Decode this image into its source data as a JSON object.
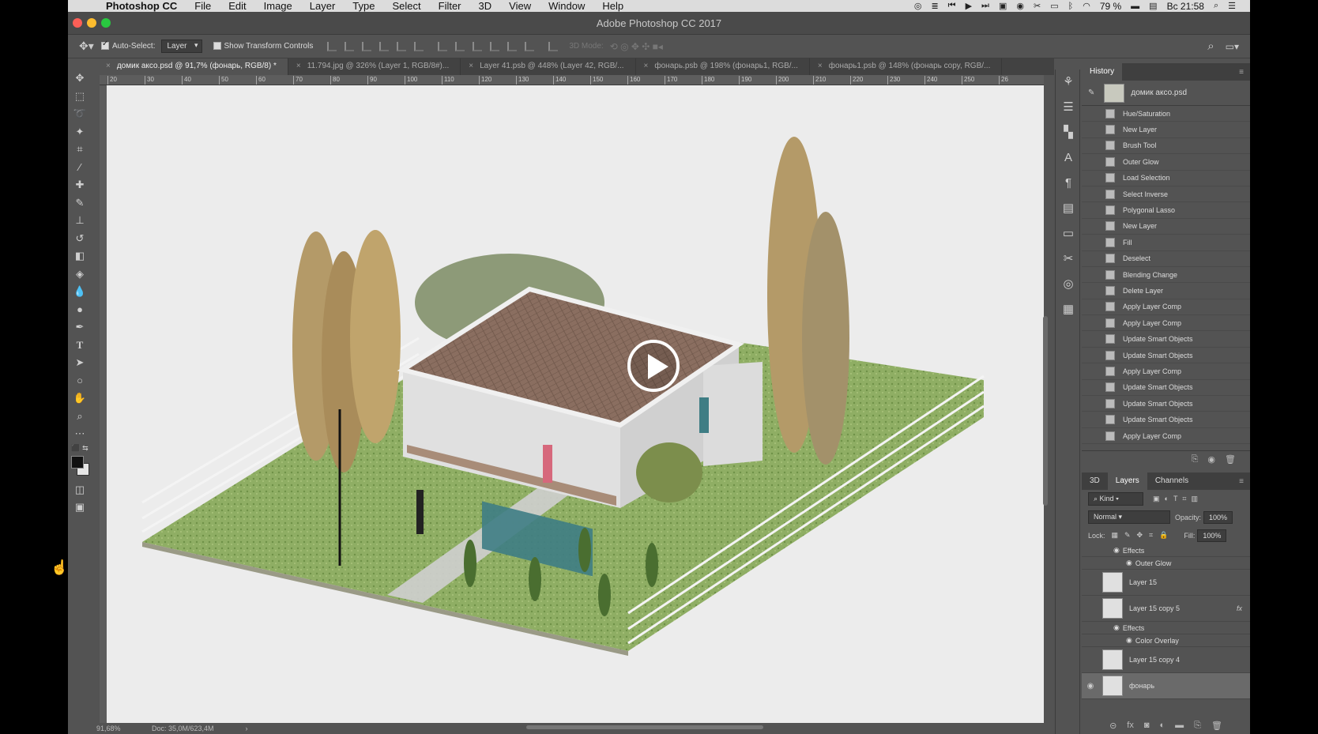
{
  "menubar": {
    "app": "Photoshop CC",
    "items": [
      "File",
      "Edit",
      "Image",
      "Layer",
      "Type",
      "Select",
      "Filter",
      "3D",
      "View",
      "Window",
      "Help"
    ],
    "battery": "79 %",
    "clock": "Вс 21:58"
  },
  "window": {
    "title": "Adobe Photoshop CC 2017"
  },
  "options": {
    "auto_select_label": "Auto-Select:",
    "auto_select_value": "Layer",
    "show_transform_label": "Show Transform Controls",
    "mode_3d": "3D Mode:"
  },
  "tabs": [
    "домик аксо.psd @ 91,7% (фонарь, RGB/8) *",
    "11.794.jpg @ 326% (Layer 1, RGB/8#)...",
    "Layer 41.psb @ 448% (Layer 42, RGB/...",
    "фонарь.psb @ 198% (фонарь1, RGB/...",
    "фонарь1.psb @ 148% (фонарь copy, RGB/..."
  ],
  "ruler_marks": [
    "20",
    "30",
    "40",
    "50",
    "60",
    "70",
    "80",
    "90",
    "100",
    "110",
    "120",
    "130",
    "140",
    "150",
    "160",
    "170",
    "180",
    "190",
    "200",
    "210",
    "220",
    "230",
    "240",
    "250",
    "26"
  ],
  "status": {
    "zoom": "91,68%",
    "doc": "Doc: 35,0M/623,4M"
  },
  "history": {
    "title": "History",
    "snapshot": "домик аксо.psd",
    "items": [
      "Hue/Saturation",
      "New Layer",
      "Brush Tool",
      "Outer Glow",
      "Load Selection",
      "Select Inverse",
      "Polygonal Lasso",
      "New Layer",
      "Fill",
      "Deselect",
      "Blending Change",
      "Delete Layer",
      "Apply Layer Comp",
      "Apply Layer Comp",
      "Update Smart Objects",
      "Update Smart Objects",
      "Apply Layer Comp",
      "Update Smart Objects",
      "Update Smart Objects",
      "Update Smart Objects",
      "Apply Layer Comp"
    ]
  },
  "layers_panel": {
    "tabs": [
      "3D",
      "Layers",
      "Channels"
    ],
    "kind": "Kind",
    "blend_mode": "Normal",
    "opacity_label": "Opacity:",
    "opacity_value": "100%",
    "lock_label": "Lock:",
    "fill_label": "Fill:",
    "fill_value": "100%",
    "effects_label": "Effects",
    "outer_glow": "Outer Glow",
    "layer_15": "Layer 15",
    "layer_15_copy5": "Layer 15 copy 5",
    "effects_label2": "Effects",
    "color_overlay": "Color Overlay",
    "layer_15_copy4": "Layer 15 copy 4",
    "fonar": "фонарь",
    "fx": "fx"
  },
  "colors": {
    "roof": "#8a6e60",
    "grass": "#8fae64",
    "wall": "#dedede",
    "window": "#3e7d84",
    "canvas_bg": "#ececec"
  }
}
